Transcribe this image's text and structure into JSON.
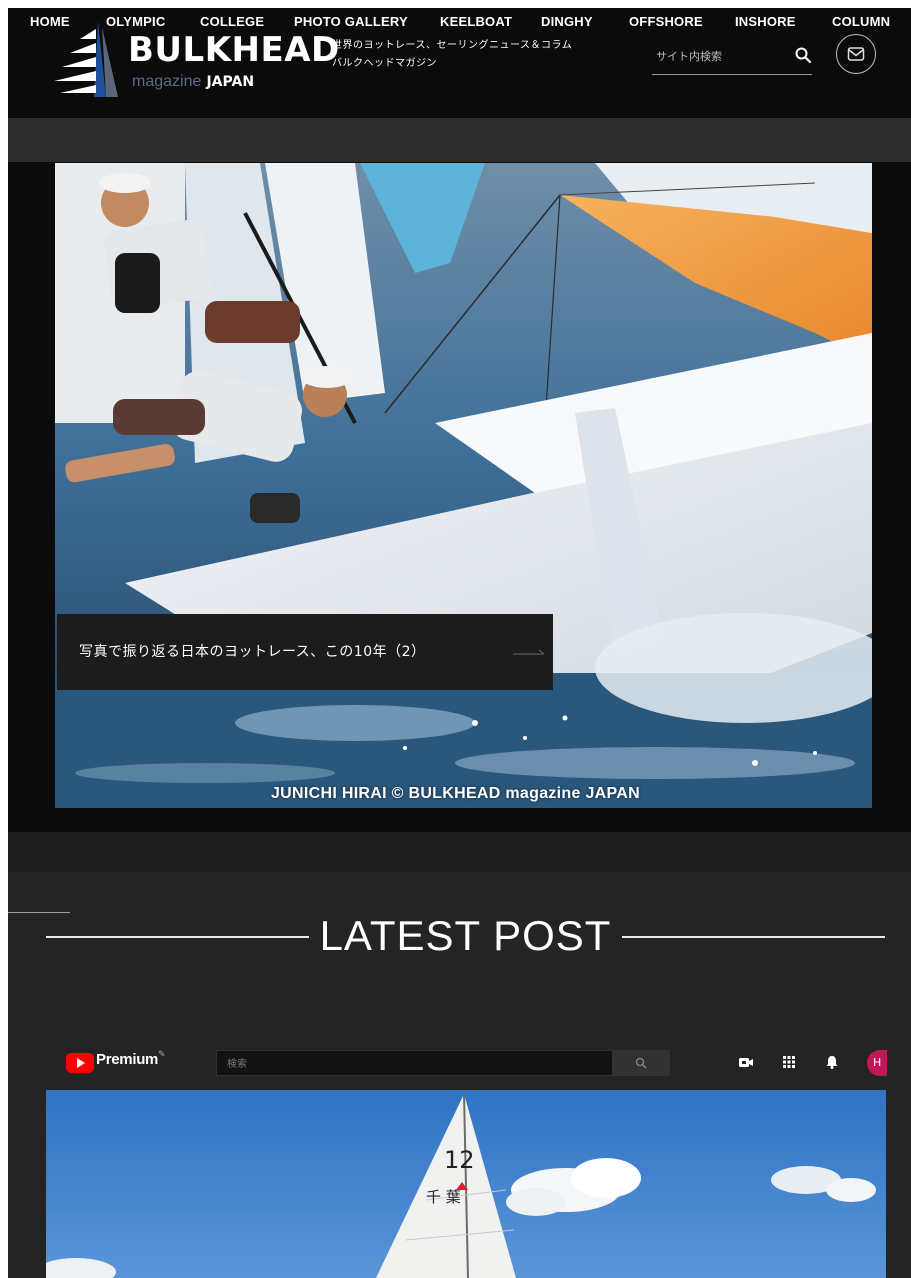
{
  "header": {
    "logo_title": "BULKHEAD",
    "logo_magazine": "magazine",
    "logo_japan": "JAPAN",
    "tagline_line1": "世界のヨットレース、セーリングニュース＆コラム",
    "tagline_line2": "バルクヘッドマガジン",
    "search_placeholder": "サイト内検索"
  },
  "nav": {
    "items": [
      "HOME",
      "OLYMPIC",
      "COLLEGE",
      "PHOTO GALLERY",
      "KEELBOAT",
      "DINGHY",
      "OFFSHORE",
      "INSHORE",
      "COLUMN"
    ]
  },
  "hero": {
    "caption": "写真で振り返る日本のヨットレース、この10年（2）",
    "photo_credit": "JUNICHI HIRAI © BULKHEAD magazine JAPAN"
  },
  "latest": {
    "title": "LATEST POST"
  },
  "youtube": {
    "brand": "Premium",
    "search_placeholder": "検索",
    "avatar_letter": "H"
  },
  "video": {
    "sail_number": "12",
    "sail_text": "千 葉"
  },
  "colors": {
    "header_bg": "#0b0b0b",
    "nav_bg": "#2d2d2d",
    "section_bg": "#242424",
    "youtube_red": "#ff0000",
    "avatar_bg": "#c2185b",
    "spinnaker_orange": "#f4a045"
  },
  "icons": [
    "logo-sail-icon",
    "search-icon",
    "mail-icon",
    "arrow-right-icon",
    "youtube-play-icon",
    "video-camera-icon",
    "apps-grid-icon",
    "bell-icon"
  ]
}
